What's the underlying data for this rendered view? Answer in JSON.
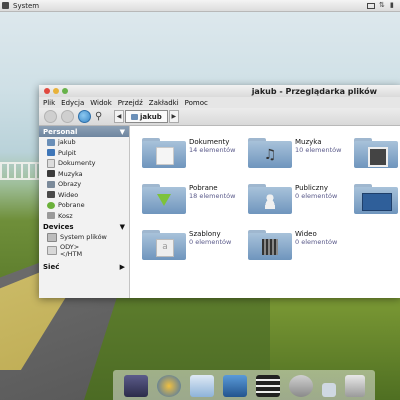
{
  "top_panel": {
    "menu_label": "System"
  },
  "window": {
    "title": "jakub - Przeglądarka plików",
    "menu": [
      "Plik",
      "Edycja",
      "Widok",
      "Przejdź",
      "Zakładki",
      "Pomoc"
    ],
    "breadcrumb": "jakub"
  },
  "sidebar": {
    "personal_header": "Personal",
    "personal_items": [
      "jakub",
      "Pulpit",
      "Dokumenty",
      "Muzyka",
      "Obrazy",
      "Wideo",
      "Pobrane",
      "Kosz"
    ],
    "devices_header": "Devices",
    "device_items": [
      "System plików",
      "ODY>\n</HTM"
    ],
    "network_header": "Sieć"
  },
  "content": {
    "items": [
      {
        "name": "Dokumenty",
        "count": "14 elementów",
        "icon": "documents-icon"
      },
      {
        "name": "Muzyka",
        "count": "10 elementów",
        "icon": "music-icon"
      },
      {
        "name": "",
        "count": "",
        "icon": "pictures-icon"
      },
      {
        "name": "Pobrane",
        "count": "18 elementów",
        "icon": "downloads-icon"
      },
      {
        "name": "Publiczny",
        "count": "0 elementów",
        "icon": "public-icon"
      },
      {
        "name": "",
        "count": "",
        "icon": "desktop-icon"
      },
      {
        "name": "Szablony",
        "count": "0 elementów",
        "icon": "templates-icon"
      },
      {
        "name": "Wideo",
        "count": "0 elementów",
        "icon": "videos-icon"
      }
    ]
  }
}
